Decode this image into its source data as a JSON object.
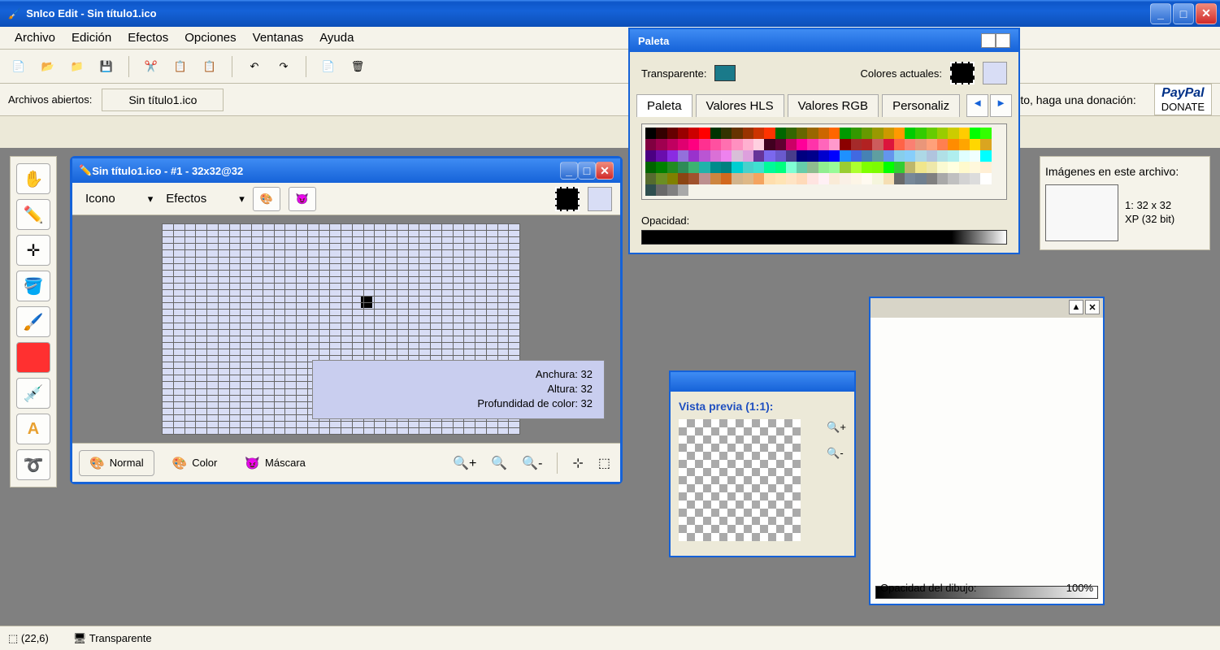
{
  "app": {
    "title": "SnIco Edit - Sin título1.ico"
  },
  "menu": {
    "archivo": "Archivo",
    "edicion": "Edición",
    "efectos": "Efectos",
    "opciones": "Opciones",
    "ventanas": "Ventanas",
    "ayuda": "Ayuda"
  },
  "filerow": {
    "label": "Archivos abiertos:",
    "tab": "Sin título1.ico",
    "donation": "Ayude a soportar este proyecto, haga una donación:",
    "paypal": "PayPal",
    "donate": "DONATE"
  },
  "doc": {
    "title": "Sin título1.ico - #1 - 32x32@32",
    "icono": "Icono",
    "efectos": "Efectos",
    "info_w": "Anchura: 32",
    "info_h": "Altura: 32",
    "info_d": "Profundidad de color: 32",
    "normal": "Normal",
    "color": "Color",
    "mascara": "Máscara"
  },
  "palette": {
    "title": "Paleta",
    "transparente": "Transparente:",
    "colores": "Colores actuales:",
    "tab_paleta": "Paleta",
    "tab_hls": "Valores HLS",
    "tab_rgb": "Valores RGB",
    "tab_pers": "Personaliz",
    "opacidad": "Opacidad:"
  },
  "preview": {
    "label": "Vista previa (1:1):"
  },
  "rpanel": {
    "label": "Imágenes en este archivo:",
    "line1": "1: 32 x 32",
    "line2": "XP (32 bit)"
  },
  "rpanel2": {
    "opac_label": "Opacidad del dibujo:",
    "opac_val": "100%"
  },
  "status": {
    "coord": "(22,6)",
    "trans": "Transparente"
  },
  "colors": {
    "rows": [
      [
        "#000000",
        "#330000",
        "#660000",
        "#990000",
        "#cc0000",
        "#ff0000",
        "#003300",
        "#333300",
        "#663300",
        "#993300",
        "#cc3300",
        "#ff3300",
        "#006600",
        "#336600",
        "#666600",
        "#996600",
        "#cc6600",
        "#ff6600",
        "#009900",
        "#339900",
        "#669900",
        "#999900",
        "#cc9900",
        "#ff9900",
        "#00cc00",
        "#33cc00",
        "#66cc00",
        "#99cc00",
        "#cccc00",
        "#ffcc00",
        "#00ff00",
        "#33ff00"
      ],
      [
        "#800040",
        "#a00050",
        "#c00060",
        "#e00070",
        "#ff0080",
        "#ff3090",
        "#ff50a0",
        "#ff70b0",
        "#ff90c0",
        "#ffb0d0",
        "#ffd0e0",
        "#400020",
        "#600030",
        "#cc0066",
        "#ff0099",
        "#ff33aa",
        "#ff66bb",
        "#ff99cc",
        "#8b0000",
        "#a52a2a",
        "#b22222",
        "#cd5c5c",
        "#dc143c",
        "#ff6347",
        "#fa8072",
        "#e9967a",
        "#ffa07a",
        "#ff7f50",
        "#ff8c00",
        "#ffa500",
        "#ffd700",
        "#daa520"
      ],
      [
        "#4b0082",
        "#6a0dad",
        "#8a2be2",
        "#9370db",
        "#9932cc",
        "#ba55d3",
        "#da70d6",
        "#ee82ee",
        "#d8bfd8",
        "#dda0dd",
        "#663399",
        "#7b68ee",
        "#6a5acd",
        "#483d8b",
        "#000080",
        "#00008b",
        "#0000cd",
        "#0000ff",
        "#1e90ff",
        "#4169e1",
        "#4682b4",
        "#5f9ea0",
        "#6495ed",
        "#87ceeb",
        "#87cefa",
        "#add8e6",
        "#b0c4de",
        "#b0e0e6",
        "#afeeee",
        "#e0ffff",
        "#f0ffff",
        "#00ffff"
      ],
      [
        "#006400",
        "#008000",
        "#228b22",
        "#2e8b57",
        "#3cb371",
        "#20b2aa",
        "#008b8b",
        "#008080",
        "#00ced1",
        "#48d1cc",
        "#40e0d0",
        "#00fa9a",
        "#00ff7f",
        "#7fffd4",
        "#66cdaa",
        "#8fbc8f",
        "#90ee90",
        "#98fb98",
        "#9acd32",
        "#adff2f",
        "#7fff00",
        "#7cfc00",
        "#00ff00",
        "#32cd32",
        "#bdb76b",
        "#f0e68c",
        "#eee8aa",
        "#fafad2",
        "#ffffe0",
        "#fffacd",
        "#fff8dc",
        "#ffefd5"
      ],
      [
        "#556b2f",
        "#6b8e23",
        "#808000",
        "#8b4513",
        "#a0522d",
        "#bc8f8f",
        "#cd853f",
        "#d2691e",
        "#d2b48c",
        "#deb887",
        "#f4a460",
        "#ffdead",
        "#ffe4b5",
        "#ffe4c4",
        "#ffdab9",
        "#ffe4e1",
        "#fff0f5",
        "#faebd7",
        "#faf0e6",
        "#fdf5e6",
        "#fffaf0",
        "#f5f5dc",
        "#f5deb3",
        "#696969",
        "#778899",
        "#708090",
        "#808080",
        "#a9a9a9",
        "#c0c0c0",
        "#d3d3d3",
        "#dcdcdc",
        "#ffffff"
      ],
      [
        "#2f4f4f",
        "#696969",
        "#808080",
        "#a9a9a9"
      ]
    ]
  }
}
